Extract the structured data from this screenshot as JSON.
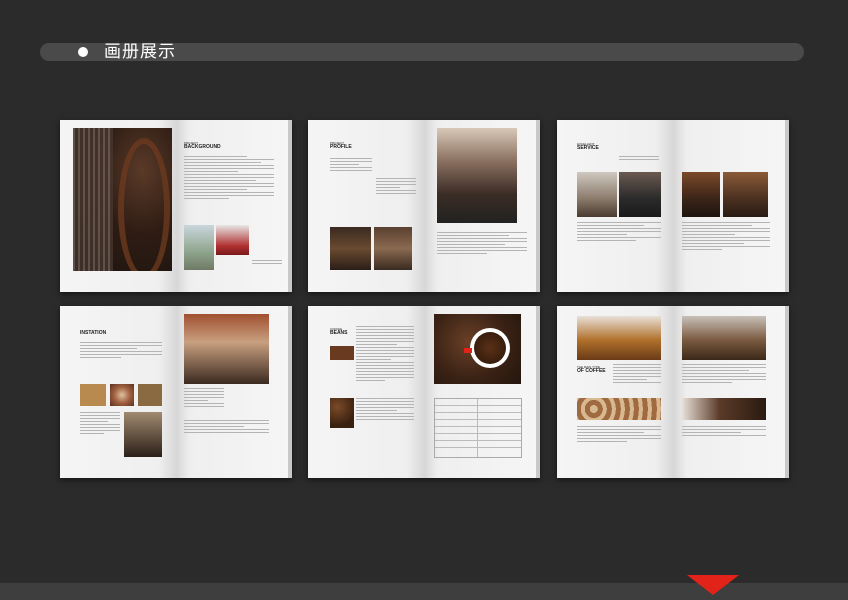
{
  "header": {
    "title": "画册展示"
  },
  "colors": {
    "background": "#2b2b2b",
    "accent": "#e2231a",
    "bar": "#4a4a4a"
  },
  "icons": {
    "title_bullet": "circle-bullet-icon",
    "next": "triangle-down-icon"
  },
  "spreads": [
    {
      "headings": {
        "h1_line1": "PROJECT",
        "h1_line2": "BACKGROUND"
      }
    },
    {
      "headings": {
        "h1_line1": "PROJECT",
        "h1_line2": "PROFILE"
      }
    },
    {
      "headings": {
        "h1_line1": "EXCELLENT",
        "h1_line2": "SERVICE"
      }
    },
    {
      "headings": {
        "h1_line1": "INSTATION"
      }
    },
    {
      "headings": {
        "h1_line1": "COFFEE",
        "h1_line2": "BEANS"
      }
    },
    {
      "headings": {
        "h1_line1": "THE MAIN TYPE",
        "h1_line2": "OF COFFEE"
      }
    }
  ]
}
